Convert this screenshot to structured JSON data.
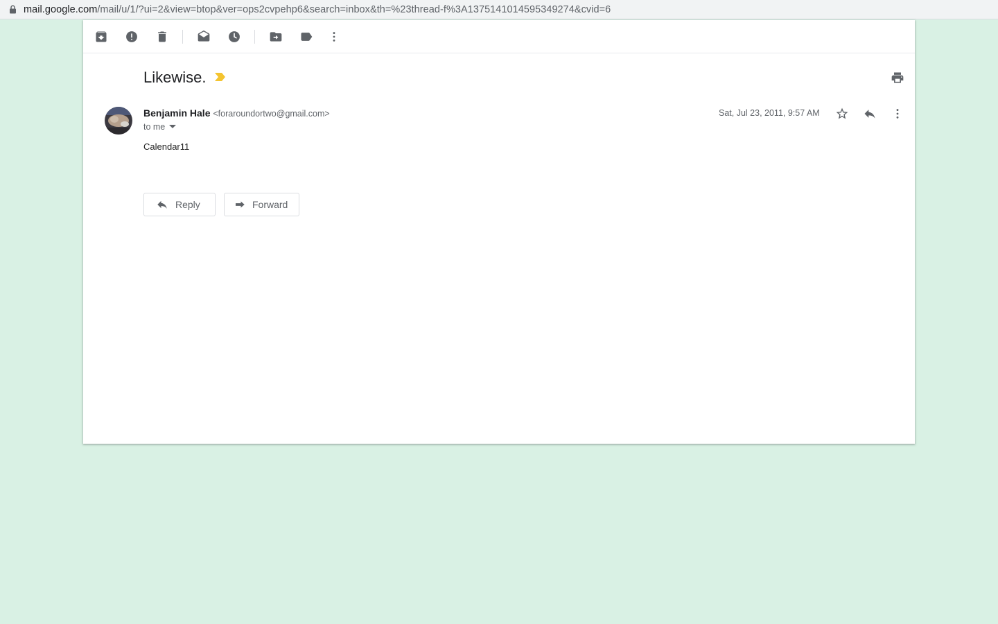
{
  "browser": {
    "url_host": "mail.google.com",
    "url_path": "/mail/u/1/?ui=2&view=btop&ver=ops2cvpehp6&search=inbox&th=%23thread-f%3A1375141014595349274&cvid=6"
  },
  "toolbar": {
    "icons": [
      "archive-icon",
      "report-spam-icon",
      "delete-icon",
      "mark-unread-icon",
      "snooze-icon",
      "move-to-icon",
      "labels-icon",
      "more-icon"
    ]
  },
  "thread": {
    "subject": "Likewise.",
    "important_color": "#f4c430"
  },
  "message": {
    "sender_name": "Benjamin Hale",
    "sender_email": "<foraroundortwo@gmail.com>",
    "to": "to me",
    "date": "Sat, Jul 23, 2011, 9:57 AM",
    "body": "Calendar11"
  },
  "actions": {
    "reply_label": "Reply",
    "forward_label": "Forward"
  },
  "colors": {
    "page_background": "#d9f1e4",
    "icon": "#5f6368"
  }
}
